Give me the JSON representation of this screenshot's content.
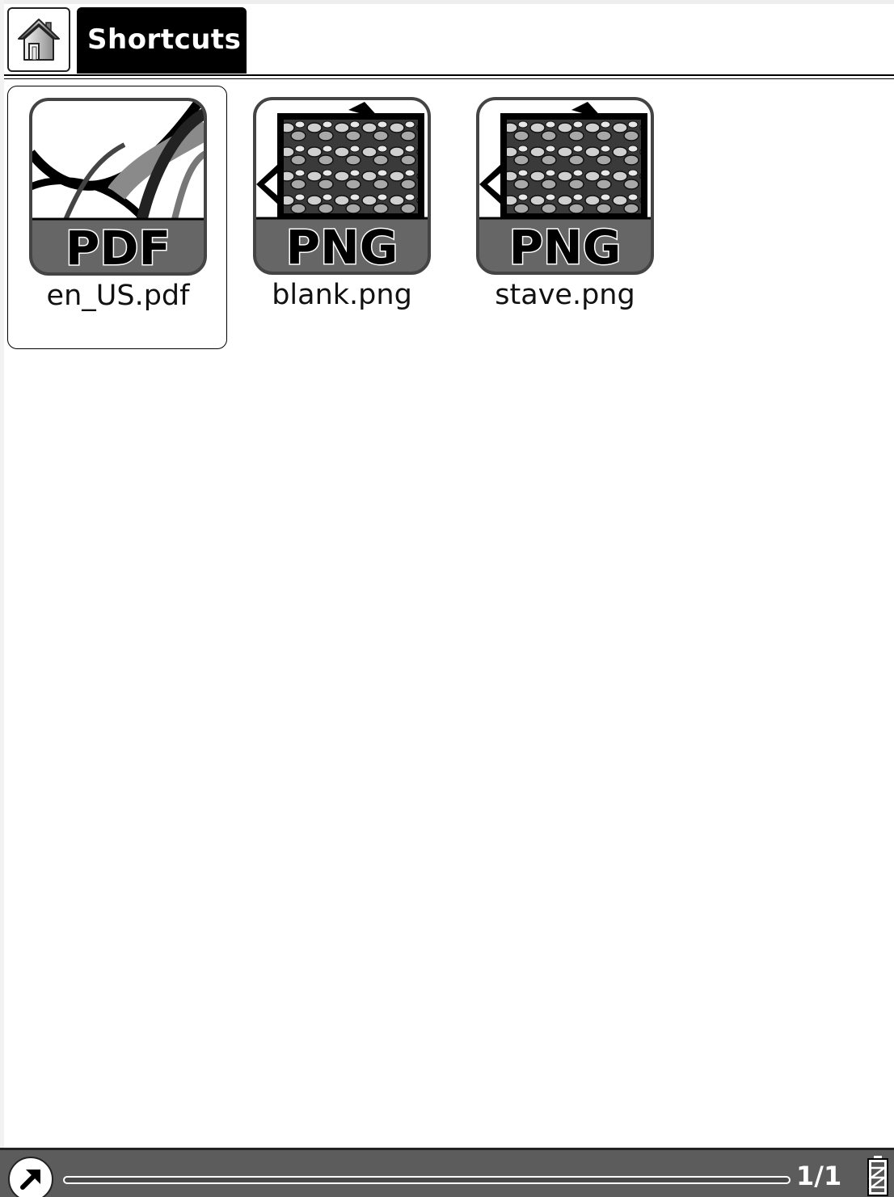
{
  "header": {
    "title": "Shortcuts",
    "home_icon": "home-icon"
  },
  "files": [
    {
      "name": "en_US.pdf",
      "type_label": "PDF",
      "icon": "pdf-file-icon",
      "selected": true
    },
    {
      "name": "blank.png",
      "type_label": "PNG",
      "icon": "png-file-icon",
      "selected": false
    },
    {
      "name": "stave.png",
      "type_label": "PNG",
      "icon": "png-file-icon",
      "selected": false
    }
  ],
  "footer": {
    "menu_icon": "arrow-up-right-icon",
    "page_indicator": "1/1",
    "battery_icon": "battery-icon"
  },
  "colors": {
    "background": "#ffffff",
    "tab_active": "#000000",
    "status_bar": "#5c5c5c"
  }
}
